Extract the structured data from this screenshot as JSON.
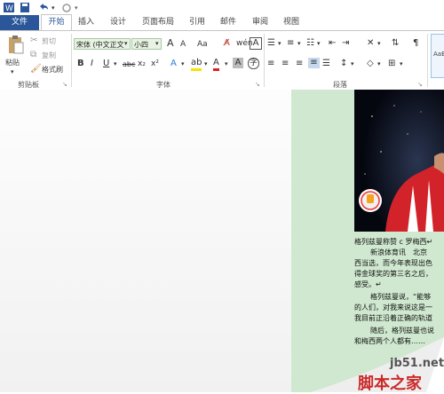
{
  "tabs": {
    "file": "文件",
    "home": "开始",
    "insert": "插入",
    "design": "设计",
    "layout": "页面布局",
    "references": "引用",
    "mailings": "邮件",
    "review": "审阅",
    "view": "视图"
  },
  "clipboard": {
    "paste": "粘贴",
    "cut": "剪切",
    "copy": "复制",
    "format_painter": "格式刷",
    "label": "剪贴板"
  },
  "font": {
    "name": "宋体 (中文正文",
    "size": "小四",
    "label": "字体",
    "grow": "A",
    "shrink": "A",
    "change_case": "Aa",
    "bold": "B",
    "italic": "I",
    "underline": "U",
    "strike": "abc",
    "sub": "x₂",
    "sup": "x²",
    "phonetic": "wén",
    "enclose": "字"
  },
  "paragraph": {
    "label": "段落"
  },
  "styles": {
    "sample": "AaB"
  },
  "document": {
    "line1": "格列兹曼称赞 c 罗梅西↵",
    "line2": "新浪体育讯　北京",
    "line3": "西当选，而今年表现出色",
    "line4": "得金球奖的第三名之后，",
    "line5": "感受。↵",
    "line6": "格列兹曼说，“能够",
    "line7": "的人们，对我来说这是一",
    "line8": "我目前正沿着正确的轨道",
    "line9": "随后，格列兹曼也说",
    "line10": "和梅西两个人都有……",
    "watermark_url": "jb51.net",
    "watermark_text": "脚本之家"
  },
  "colors": {
    "accent": "#2b579a",
    "page_bg": "#cfe8cf"
  }
}
